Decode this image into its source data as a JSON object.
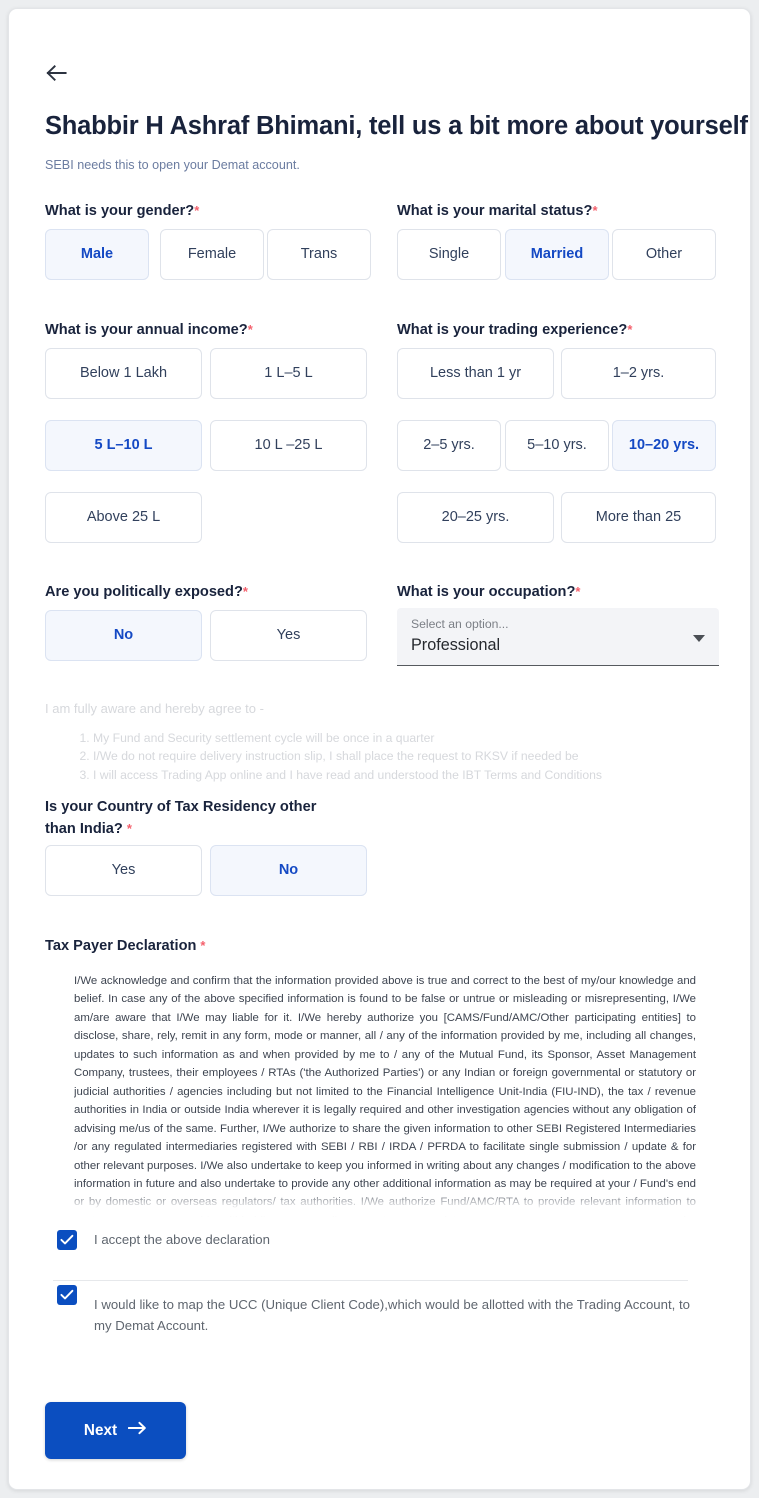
{
  "header": {
    "back_icon": "arrow-left-icon",
    "title": "Shabbir H Ashraf Bhimani, tell us a bit more about yourself",
    "subtitle": "SEBI needs this to open your Demat account.",
    "required_marker": "*"
  },
  "gender": {
    "label": "What is your gender?",
    "options": [
      {
        "label": "Male",
        "selected": true
      },
      {
        "label": "Female",
        "selected": false
      },
      {
        "label": "Trans",
        "selected": false
      }
    ]
  },
  "marital": {
    "label": "What is your marital status?",
    "options": [
      {
        "label": "Single",
        "selected": false
      },
      {
        "label": "Married",
        "selected": true
      },
      {
        "label": "Other",
        "selected": false
      }
    ]
  },
  "income": {
    "label": "What is your annual income?",
    "options": [
      {
        "label": "Below 1 Lakh",
        "selected": false
      },
      {
        "label": "1 L–5 L",
        "selected": false
      },
      {
        "label": "5 L–10 L",
        "selected": true
      },
      {
        "label": "10 L –25 L",
        "selected": false
      },
      {
        "label": "Above 25 L",
        "selected": false
      }
    ]
  },
  "trading": {
    "label": "What is your trading experience?",
    "options": [
      {
        "label": "Less than 1 yr",
        "selected": false
      },
      {
        "label": "1–2 yrs.",
        "selected": false
      },
      {
        "label": "2–5 yrs.",
        "selected": false
      },
      {
        "label": "5–10 yrs.",
        "selected": false
      },
      {
        "label": "10–20 yrs.",
        "selected": true
      },
      {
        "label": "20–25 yrs.",
        "selected": false
      },
      {
        "label": "More than 25",
        "selected": false
      }
    ]
  },
  "politically_exposed": {
    "label": "Are you politically exposed?",
    "options": [
      {
        "label": "No",
        "selected": true
      },
      {
        "label": "Yes",
        "selected": false
      }
    ]
  },
  "occupation": {
    "label": "What is your occupation?",
    "placeholder": "Select an option...",
    "value": "Professional",
    "caret_icon": "chevron-down-icon"
  },
  "agreement": {
    "lead": "I am fully aware and hereby agree to -",
    "items": [
      "My Fund and Security settlement cycle will be once in a quarter",
      "I/We do not require delivery instruction slip, I shall place the request to RKSV if needed be",
      "I will access Trading App online and I have read and understood the IBT Terms and Conditions"
    ]
  },
  "tax_residency": {
    "label": "Is your Country of Tax Residency other than India?",
    "options": [
      {
        "label": "Yes",
        "selected": false
      },
      {
        "label": "No",
        "selected": true
      }
    ]
  },
  "declaration": {
    "heading": "Tax Payer Declaration",
    "body": "I/We acknowledge and confirm that the information provided above is true and correct to the best of my/our knowledge and belief. In case any of the above specified information is found to be false or untrue or misleading or misrepresenting, I/We am/are aware that I/We may liable for it. I/We hereby authorize you [CAMS/Fund/AMC/Other participating entities] to disclose, share, rely, remit in any form, mode or manner, all / any of the information provided by me, including all changes, updates to such information as and when provided by me to / any of the Mutual Fund, its Sponsor, Asset Management Company, trustees, their employees / RTAs ('the Authorized Parties') or any Indian or foreign governmental or statutory or judicial authorities / agencies including but not limited to the Financial Intelligence Unit-India (FIU-IND), the tax / revenue authorities in India or outside India wherever it is legally required and other investigation agencies without any obligation of advising me/us of the same. Further, I/We authorize to share the given information to other SEBI Registered Intermediaries /or any regulated intermediaries registered with SEBI / RBI / IRDA / PFRDA to facilitate single submission / update & for other relevant purposes. I/We also undertake to keep you informed in writing about any changes / modification to the above information in future and also undertake to provide any other additional information as may be required at your / Fund's end or by domestic or overseas regulators/ tax authorities. I/We authorize Fund/AMC/RTA to provide relevant information to upstream payors to enable withholding tax compliance or to any regulators or any agency or any person as may be required."
  },
  "accept_declaration": {
    "label": "I accept the above declaration",
    "checked": true,
    "check_icon": "check-icon"
  },
  "ucc_mapping": {
    "label": "I would like to map the UCC (Unique Client Code),which would be allotted with the Trading Account, to my Demat Account.",
    "checked": true,
    "check_icon": "check-icon"
  },
  "footer": {
    "next_label": "Next",
    "next_icon": "arrow-right-icon"
  },
  "colors": {
    "accent": "#0b4ec0",
    "selected_text": "#1449c4",
    "selected_bg": "#f4f7fd",
    "required": "#f4606c",
    "title": "#19233c",
    "subtitle": "#6b7ca0"
  }
}
